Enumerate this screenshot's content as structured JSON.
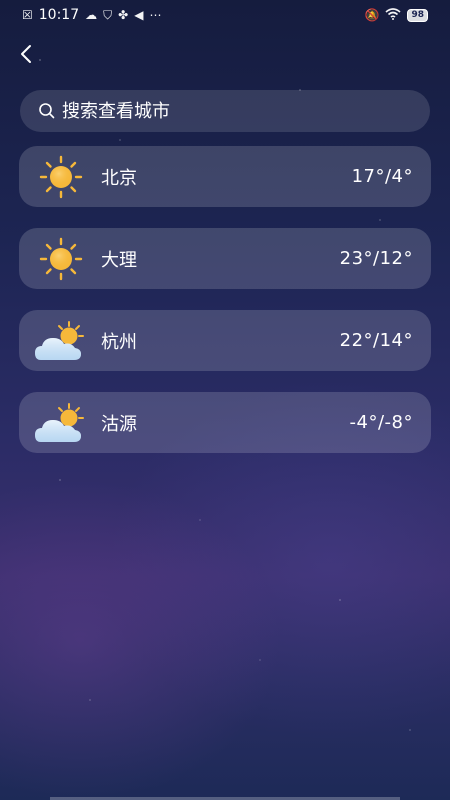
{
  "status_bar": {
    "time": "10:17",
    "battery": "98"
  },
  "search": {
    "placeholder": "搜索查看城市"
  },
  "cities": [
    {
      "name": "北京",
      "temp": "17°/4°",
      "icon": "sun-icon"
    },
    {
      "name": "大理",
      "temp": "23°/12°",
      "icon": "sun-icon"
    },
    {
      "name": "杭州",
      "temp": "22°/14°",
      "icon": "partly-cloudy-icon"
    },
    {
      "name": "沽源",
      "temp": "-4°/-8°",
      "icon": "partly-cloudy-icon"
    }
  ],
  "colors": {
    "sun": "#f6b83a",
    "cloud": "#c9e2f7"
  }
}
